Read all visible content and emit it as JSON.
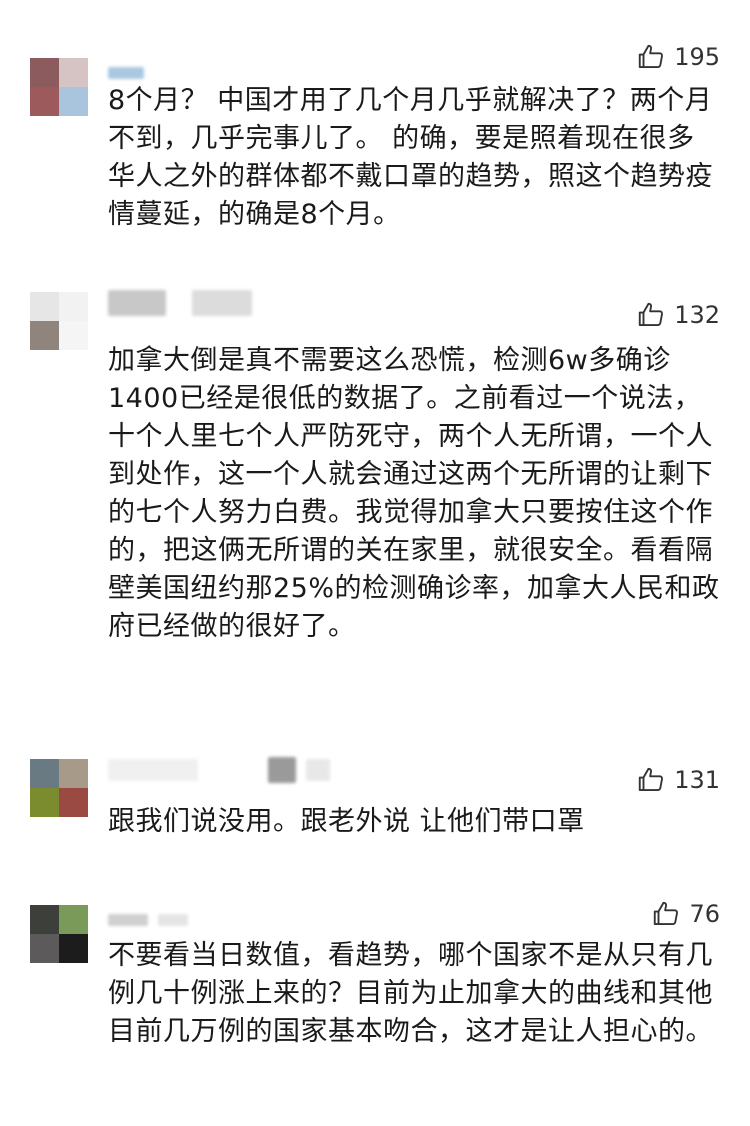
{
  "comments": [
    {
      "likes": "195",
      "text": "8个月？ 中国才用了几个月几乎就解决了？两个月不到，几乎完事儿了。 的确，要是照着现在很多华人之外的群体都不戴口罩的趋势，照这个趋势疫情蔓延，的确是8个月。",
      "avatar_colors": [
        "#8c5b5e",
        "#d6c4c4",
        "#9c5a5d",
        "#a9c5de"
      ]
    },
    {
      "likes": "132",
      "text": "加拿大倒是真不需要这么恐慌，检测6w多确诊1400已经是很低的数据了。之前看过一个说法，十个人里七个人严防死守，两个人无所谓，一个人到处作，这一个人就会通过这两个无所谓的让剩下的七个人努力白费。我觉得加拿大只要按住这个作的，把这俩无所谓的关在家里，就很安全。看看隔壁美国纽约那25%的检测确诊率，加拿大人民和政府已经做的很好了。",
      "avatar_colors": [
        "#e6e6e6",
        "#f2f2f2",
        "#8f857c",
        "#f5f5f5"
      ]
    },
    {
      "likes": "131",
      "text": "跟我们说没用。跟老外说 让他们带口罩",
      "avatar_colors": [
        "#6a7a82",
        "#a89a88",
        "#7b8c2f",
        "#9b4a43"
      ]
    },
    {
      "likes": "76",
      "text": "不要看当日数值，看趋势，哪个国家不是从只有几例几十例涨上来的？目前为止加拿大的曲线和其他目前几万例的国家基本吻合，这才是让人担心的。",
      "avatar_colors": [
        "#3c3f3a",
        "#7a9a5a",
        "#5d5a5c",
        "#1c1c1c"
      ]
    }
  ],
  "icons": {
    "like": "thumbs-up-icon"
  },
  "colors": {
    "text": "#1a1a1a",
    "like": "#333333",
    "background": "#ffffff"
  }
}
